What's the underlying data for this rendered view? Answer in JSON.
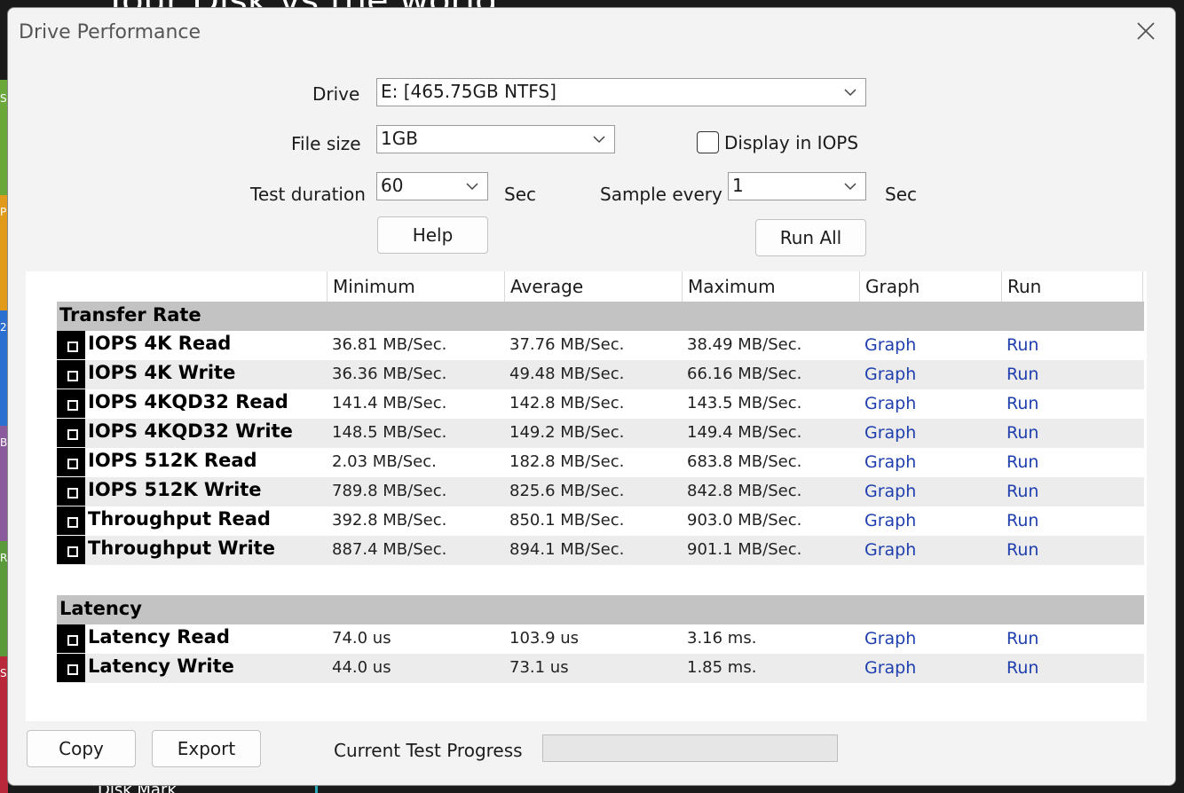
{
  "background": {
    "title": "Your Disk vs the world",
    "bottom_text": "Disk Mark",
    "side_letters": [
      "S",
      "P",
      "2",
      "B",
      "R",
      "S"
    ]
  },
  "dialog": {
    "title": "Drive Performance",
    "close_icon": "close-icon"
  },
  "form": {
    "drive_label": "Drive",
    "drive_value": "E: [465.75GB NTFS]",
    "file_size_label": "File size",
    "file_size_value": "1GB",
    "display_iops_label": "Display in IOPS",
    "display_iops_checked": false,
    "test_duration_label": "Test duration",
    "test_duration_value": "60",
    "test_duration_unit": "Sec",
    "sample_every_label": "Sample every",
    "sample_every_value": "1",
    "sample_every_unit": "Sec",
    "help_label": "Help",
    "run_all_label": "Run All"
  },
  "table": {
    "columns": [
      "Minimum",
      "Average",
      "Maximum",
      "Graph",
      "Run"
    ],
    "sections": [
      {
        "title": "Transfer Rate",
        "rows": [
          {
            "name": "IOPS 4K Read",
            "min": "36.81 MB/Sec.",
            "avg": "37.76 MB/Sec.",
            "max": "38.49 MB/Sec.",
            "graph": "Graph",
            "run": "Run"
          },
          {
            "name": "IOPS 4K Write",
            "min": "36.36 MB/Sec.",
            "avg": "49.48 MB/Sec.",
            "max": "66.16 MB/Sec.",
            "graph": "Graph",
            "run": "Run"
          },
          {
            "name": "IOPS 4KQD32 Read",
            "min": "141.4 MB/Sec.",
            "avg": "142.8 MB/Sec.",
            "max": "143.5 MB/Sec.",
            "graph": "Graph",
            "run": "Run"
          },
          {
            "name": "IOPS 4KQD32 Write",
            "min": "148.5 MB/Sec.",
            "avg": "149.2 MB/Sec.",
            "max": "149.4 MB/Sec.",
            "graph": "Graph",
            "run": "Run"
          },
          {
            "name": "IOPS 512K Read",
            "min": "2.03 MB/Sec.",
            "avg": "182.8 MB/Sec.",
            "max": "683.8 MB/Sec.",
            "graph": "Graph",
            "run": "Run"
          },
          {
            "name": "IOPS 512K Write",
            "min": "789.8 MB/Sec.",
            "avg": "825.6 MB/Sec.",
            "max": "842.8 MB/Sec.",
            "graph": "Graph",
            "run": "Run"
          },
          {
            "name": "Throughput Read",
            "min": "392.8 MB/Sec.",
            "avg": "850.1 MB/Sec.",
            "max": "903.0 MB/Sec.",
            "graph": "Graph",
            "run": "Run"
          },
          {
            "name": "Throughput Write",
            "min": "887.4 MB/Sec.",
            "avg": "894.1 MB/Sec.",
            "max": "901.1 MB/Sec.",
            "graph": "Graph",
            "run": "Run"
          }
        ]
      },
      {
        "title": "Latency",
        "rows": [
          {
            "name": "Latency Read",
            "min": "74.0 us",
            "avg": "103.9 us",
            "max": "3.16 ms.",
            "graph": "Graph",
            "run": "Run"
          },
          {
            "name": "Latency Write",
            "min": "44.0 us",
            "avg": "73.1 us",
            "max": "1.85 ms.",
            "graph": "Graph",
            "run": "Run"
          }
        ]
      }
    ]
  },
  "footer": {
    "copy_label": "Copy",
    "export_label": "Export",
    "progress_label": "Current Test Progress",
    "progress_fraction": 0
  },
  "colors": {
    "link": "#1f3fae",
    "section_bg": "#c3c3c3",
    "alt_row_bg": "#ececec",
    "tile_colors": [
      "#6aa83a",
      "#e29a1a",
      "#2b6fd1",
      "#8a5a9c",
      "#5a9a3a",
      "#b8283a"
    ]
  }
}
